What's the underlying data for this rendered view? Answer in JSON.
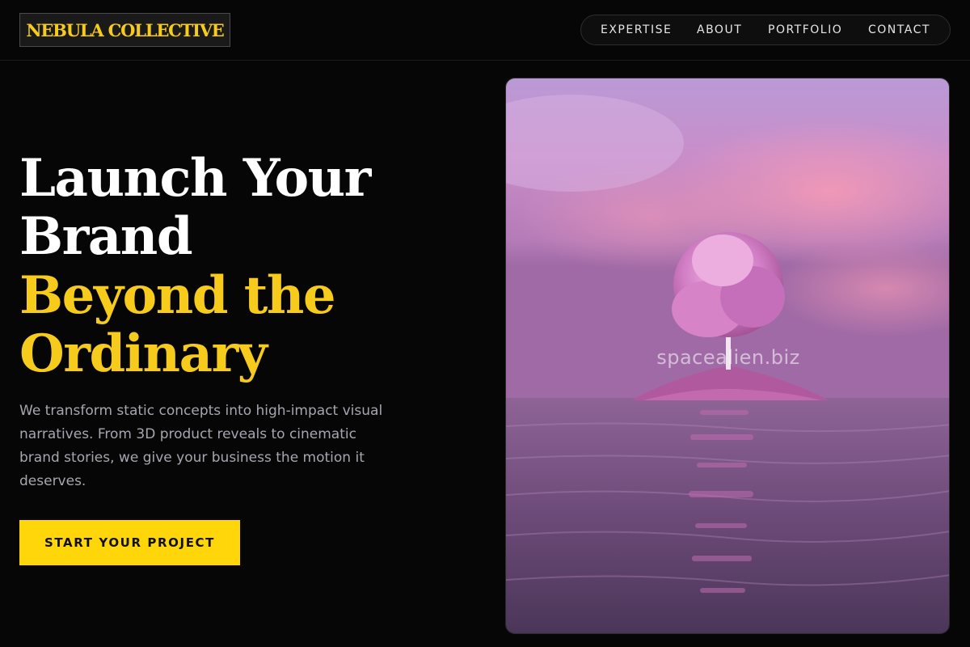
{
  "brand": {
    "logo_text": "NEBULA COLLECTIVE"
  },
  "nav": {
    "items": [
      "EXPERTISE",
      "ABOUT",
      "PORTFOLIO",
      "CONTACT"
    ]
  },
  "hero": {
    "headline_white": [
      "Launch Your",
      "Brand"
    ],
    "headline_accent": [
      "Beyond the",
      "Ordinary"
    ],
    "description": "We transform static concepts into high-impact visual narratives. From 3D product reveals to cinematic brand stories, we give your business the motion it deserves.",
    "cta_label": "START YOUR PROJECT"
  },
  "image": {
    "watermark": "spacealien.biz",
    "subject": "pink tree on small island in calm water at dusk"
  },
  "colors": {
    "accent": "#ffd60a",
    "logo_text": "#f6cb1c",
    "background": "#060606",
    "body_text": "#a6a6b0"
  }
}
